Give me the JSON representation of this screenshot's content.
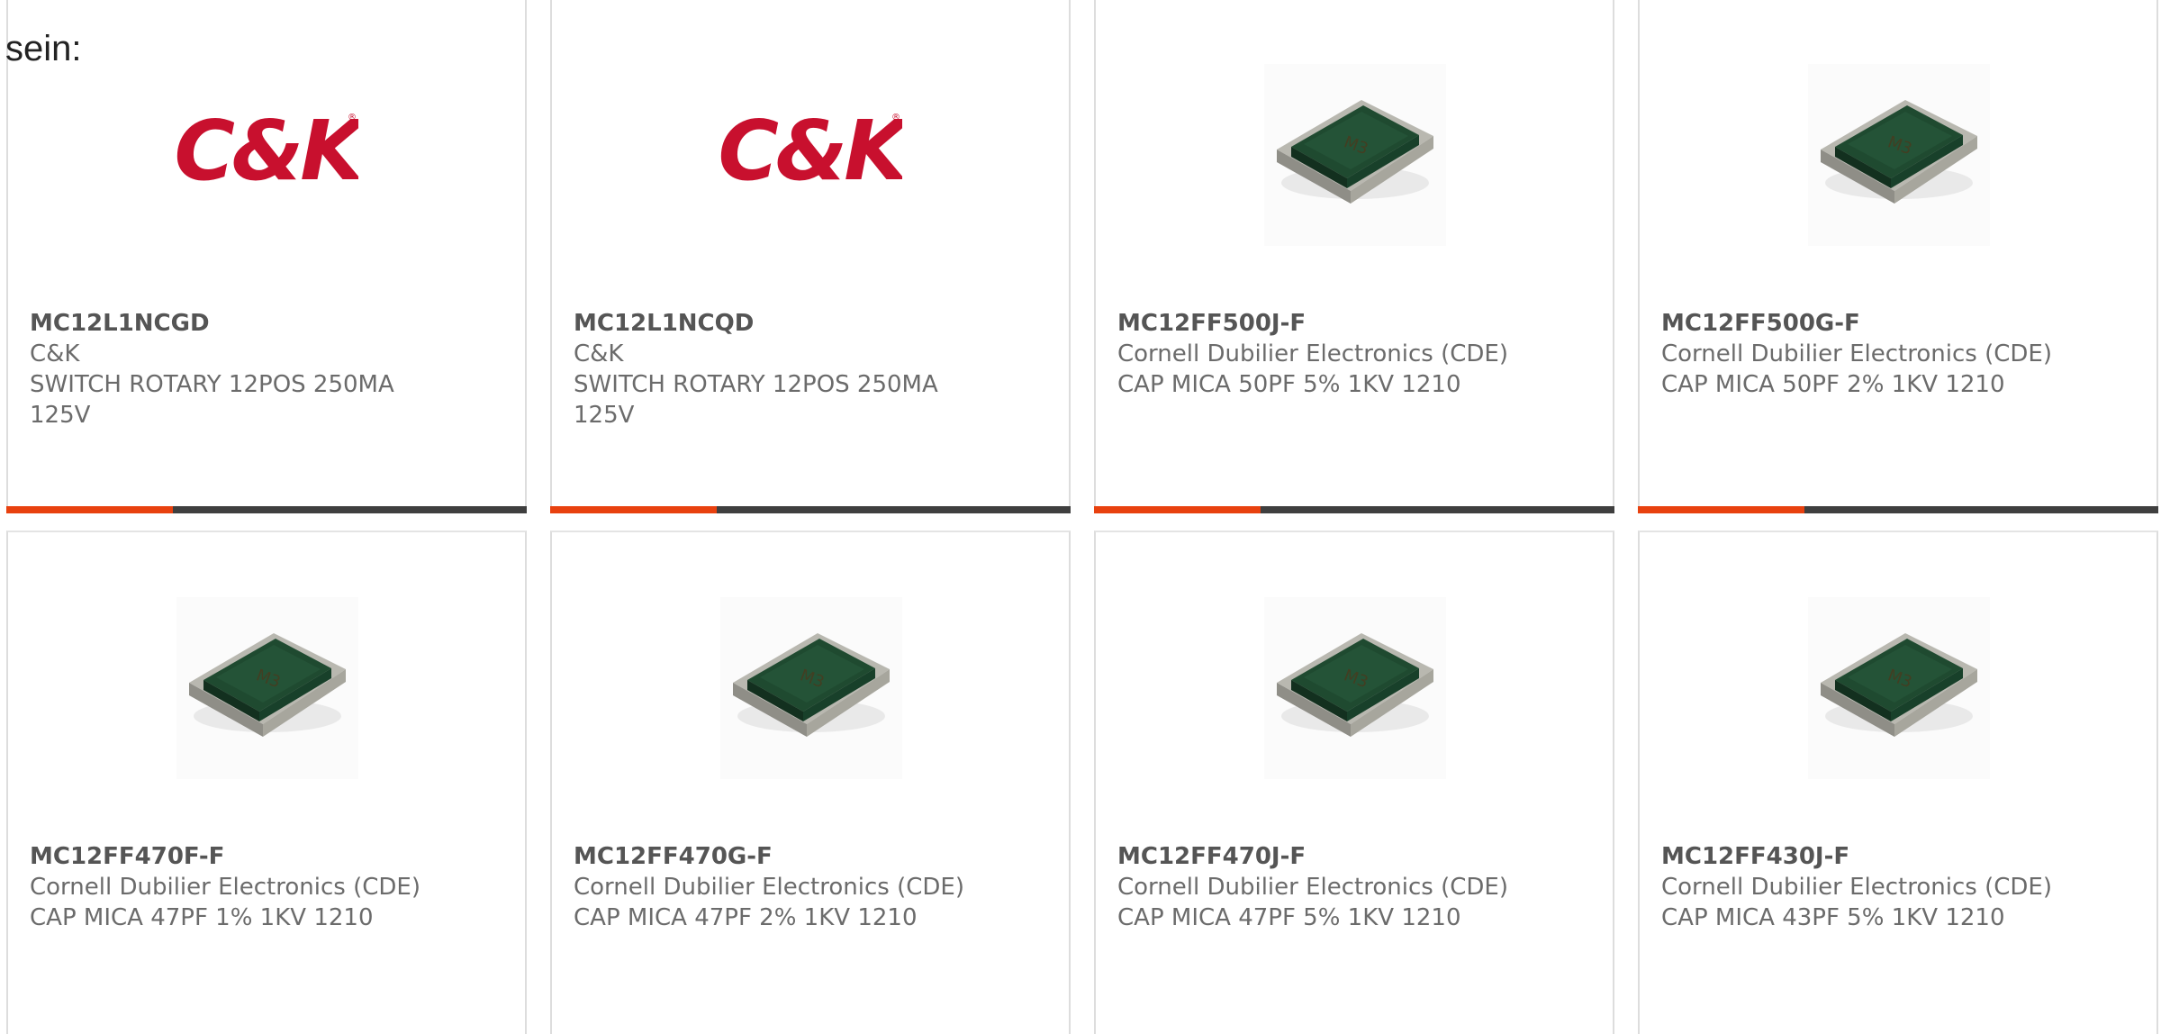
{
  "intro_text": "sein:",
  "colors": {
    "accent": "#e8410f",
    "bar_track": "#3f3f3f",
    "card_border": "#dddddd",
    "logo_red": "#c8102e",
    "logo_black": "#111111",
    "chip_body": "#1f4a30"
  },
  "cards": [
    {
      "part_number": "MC12L1NCGD",
      "manufacturer": "C&K",
      "description": "SWITCH ROTARY 12POS 250MA 125V",
      "image": "ck-logo",
      "logo_text": "C&K",
      "logo_mark": "®",
      "progress": 0.32
    },
    {
      "part_number": "MC12L1NCQD",
      "manufacturer": "C&K",
      "description": "SWITCH ROTARY 12POS 250MA 125V",
      "image": "ck-logo",
      "logo_text": "C&K",
      "logo_mark": "®",
      "progress": 0.32
    },
    {
      "part_number": "MC12FF500J-F",
      "manufacturer": "Cornell Dubilier Electronics (CDE)",
      "description": "CAP MICA 50PF 5% 1KV 1210",
      "image": "mica-capacitor-chip",
      "progress": 0.32
    },
    {
      "part_number": "MC12FF500G-F",
      "manufacturer": "Cornell Dubilier Electronics (CDE)",
      "description": "CAP MICA 50PF 2% 1KV 1210",
      "image": "mica-capacitor-chip",
      "progress": 0.32
    },
    {
      "part_number": "MC12FF470F-F",
      "manufacturer": "Cornell Dubilier Electronics (CDE)",
      "description": "CAP MICA 47PF 1% 1KV 1210",
      "image": "mica-capacitor-chip"
    },
    {
      "part_number": "MC12FF470G-F",
      "manufacturer": "Cornell Dubilier Electronics (CDE)",
      "description": "CAP MICA 47PF 2% 1KV 1210",
      "image": "mica-capacitor-chip"
    },
    {
      "part_number": "MC12FF470J-F",
      "manufacturer": "Cornell Dubilier Electronics (CDE)",
      "description": "CAP MICA 47PF 5% 1KV 1210",
      "image": "mica-capacitor-chip"
    },
    {
      "part_number": "MC12FF430J-F",
      "manufacturer": "Cornell Dubilier Electronics (CDE)",
      "description": "CAP MICA 43PF 5% 1KV 1210",
      "image": "mica-capacitor-chip"
    }
  ]
}
